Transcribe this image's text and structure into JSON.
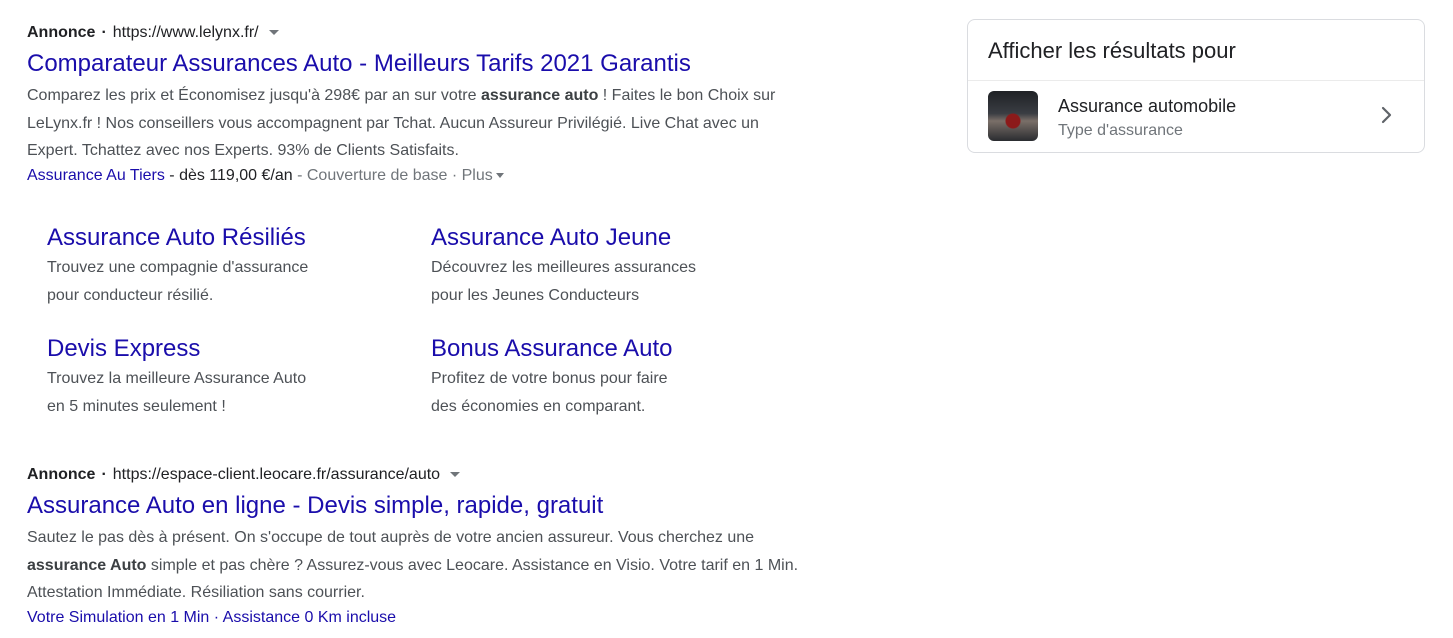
{
  "ads": [
    {
      "label": "Annonce",
      "url": "https://www.lelynx.fr/",
      "title": "Comparateur Assurances Auto - Meilleurs Tarifs 2021 Garantis",
      "desc_1": "Comparez les prix et Économisez jusqu'à 298€ par an sur votre ",
      "desc_bold": "assurance auto",
      "desc_2": " ! Faites le bon Choix sur LeLynx.fr ! Nos conseillers vous accompagnent par Tchat. Aucun Assureur Privilégié. Live Chat avec un Expert. Tchattez avec nos Experts. 93% de Clients Satisfaits.",
      "ext_link": "Assurance Au Tiers",
      "ext_price": " - dès 119,00 €/an",
      "ext_gray": " - Couverture de base · Plus"
    },
    {
      "label": "Annonce",
      "url": "https://espace-client.leocare.fr/assurance/auto",
      "title": "Assurance Auto en ligne - Devis simple, rapide, gratuit",
      "desc_1": "Sautez le pas dès à présent. On s'occupe de tout auprès de votre ancien assureur. Vous cherchez une ",
      "desc_bold": "assurance Auto",
      "desc_2": " simple et pas chère ? Assurez-vous avec Leocare. Assistance en Visio. Votre tarif en 1 Min. Attestation Immédiate. Résiliation sans courrier.",
      "ext_link_1": "Votre Simulation en 1 Min",
      "ext_sep": " · ",
      "ext_link_2": "Assistance 0 Km incluse"
    }
  ],
  "sitelinks": [
    {
      "title": "Assurance Auto Résiliés",
      "line1": "Trouvez une compagnie d'assurance",
      "line2": "pour conducteur résilié."
    },
    {
      "title": "Assurance Auto Jeune",
      "line1": "Découvrez les meilleures assurances",
      "line2": "pour les Jeunes Conducteurs"
    },
    {
      "title": "Devis Express",
      "line1": "Trouvez la meilleure Assurance Auto",
      "line2": "en 5 minutes seulement !"
    },
    {
      "title": "Bonus Assurance Auto",
      "line1": "Profitez de votre bonus pour faire",
      "line2": "des économies en comparant."
    }
  ],
  "panel": {
    "title": "Afficher les résultats pour",
    "item_name": "Assurance automobile",
    "item_type": "Type d'assurance"
  },
  "colors": {
    "link": "#1a0dab",
    "text": "#4d5156",
    "gray": "#70757a"
  },
  "icons": {
    "caret": "caret-down-icon",
    "chevron": "chevron-right-icon"
  }
}
